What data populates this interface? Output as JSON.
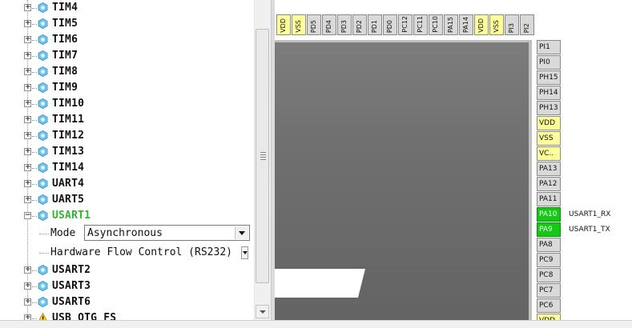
{
  "tree": {
    "nodes": [
      {
        "label": "TIM4",
        "icon": "peripheral-icon"
      },
      {
        "label": "TIM5",
        "icon": "peripheral-icon"
      },
      {
        "label": "TIM6",
        "icon": "peripheral-icon"
      },
      {
        "label": "TIM7",
        "icon": "peripheral-icon"
      },
      {
        "label": "TIM8",
        "icon": "peripheral-icon"
      },
      {
        "label": "TIM9",
        "icon": "peripheral-icon"
      },
      {
        "label": "TIM10",
        "icon": "peripheral-icon"
      },
      {
        "label": "TIM11",
        "icon": "peripheral-icon"
      },
      {
        "label": "TIM12",
        "icon": "peripheral-icon"
      },
      {
        "label": "TIM13",
        "icon": "peripheral-icon"
      },
      {
        "label": "TIM14",
        "icon": "peripheral-icon"
      },
      {
        "label": "UART4",
        "icon": "peripheral-icon"
      },
      {
        "label": "UART5",
        "icon": "peripheral-icon"
      },
      {
        "label": "USART1",
        "icon": "peripheral-icon",
        "expanded": true,
        "active": true
      },
      {
        "label": "USART2",
        "icon": "peripheral-icon"
      },
      {
        "label": "USART3",
        "icon": "peripheral-icon"
      },
      {
        "label": "USART6",
        "icon": "peripheral-icon"
      },
      {
        "label": "USB_OTG_FS",
        "icon": "warning-icon"
      }
    ],
    "usart1": {
      "mode_label": "Mode",
      "mode_value": "Asynchronous",
      "flow_label": "Hardware Flow Control (RS232)"
    }
  },
  "chip": {
    "top_pins": [
      {
        "name": "VDD",
        "power": true
      },
      {
        "name": "VSS",
        "power": true
      },
      {
        "name": "PD5"
      },
      {
        "name": "PD4"
      },
      {
        "name": "PD3"
      },
      {
        "name": "PD2"
      },
      {
        "name": "PD1"
      },
      {
        "name": "PD0"
      },
      {
        "name": "PC12"
      },
      {
        "name": "PC11"
      },
      {
        "name": "PC10"
      },
      {
        "name": "PA15"
      },
      {
        "name": "PA14"
      },
      {
        "name": "VDD",
        "power": true
      },
      {
        "name": "VSS",
        "power": true
      },
      {
        "name": "PI3"
      },
      {
        "name": "PI2"
      }
    ],
    "right_pins": [
      {
        "name": "PI1"
      },
      {
        "name": "PI0"
      },
      {
        "name": "PH15"
      },
      {
        "name": "PH14"
      },
      {
        "name": "PH13"
      },
      {
        "name": "VDD",
        "power": true
      },
      {
        "name": "VSS",
        "power": true
      },
      {
        "name": "VC..",
        "power": true
      },
      {
        "name": "PA13"
      },
      {
        "name": "PA12"
      },
      {
        "name": "PA11"
      },
      {
        "name": "PA10",
        "assigned": true,
        "signal": "USART1_RX"
      },
      {
        "name": "PA9",
        "assigned": true,
        "signal": "USART1_TX"
      },
      {
        "name": "PA8"
      },
      {
        "name": "PC9"
      },
      {
        "name": "PC8"
      },
      {
        "name": "PC7"
      },
      {
        "name": "PC6"
      },
      {
        "name": "VDD",
        "power": true
      }
    ],
    "colors": {
      "assigned": "#14c814",
      "power": "#ffff9a",
      "default": "#d9d9d9",
      "active_label": "#2fb52f"
    }
  }
}
